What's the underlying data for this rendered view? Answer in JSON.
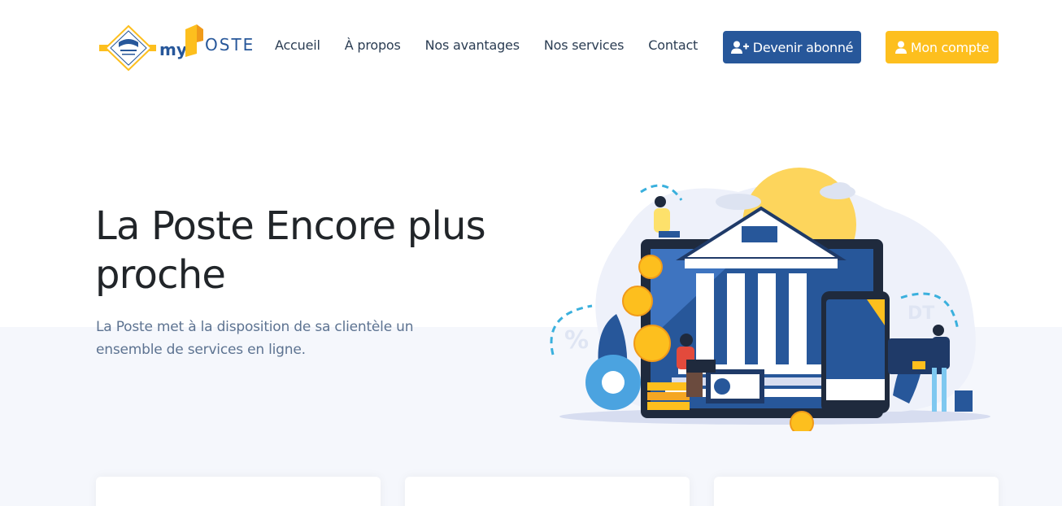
{
  "brand": {
    "name": "myPOSTE",
    "logo_prefix": "my",
    "logo_suffix": "OSTE"
  },
  "nav": {
    "items": [
      {
        "label": "Accueil"
      },
      {
        "label": "À propos"
      },
      {
        "label": "Nos avantages"
      },
      {
        "label": "Nos services"
      },
      {
        "label": "Contact"
      }
    ]
  },
  "actions": {
    "subscribe_label": "Devenir abonné",
    "account_label": "Mon compte"
  },
  "hero": {
    "title": "La Poste Encore plus proche",
    "description": "La Poste met à la disposition de sa clientèle un ensemble de services en ligne."
  },
  "colors": {
    "primary": "#27579a",
    "accent": "#fdbf1e",
    "text_dark": "#212529",
    "text_muted": "#5d7391"
  }
}
